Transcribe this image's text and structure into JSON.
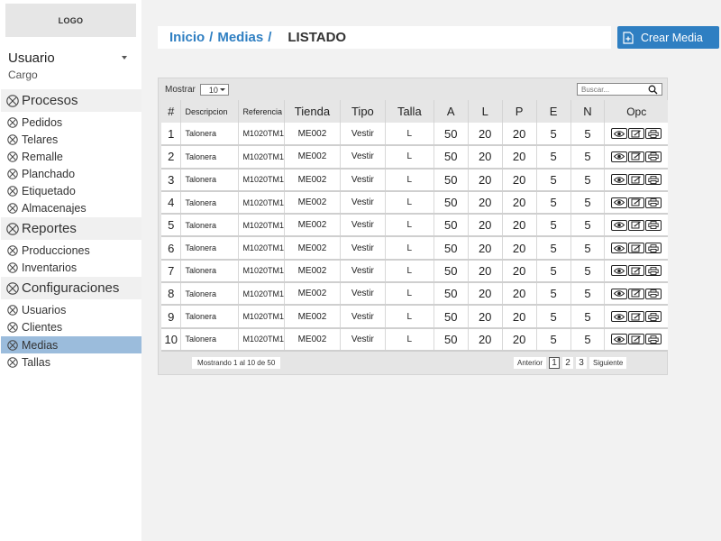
{
  "sidebar": {
    "logo": "LOGO",
    "user_name": "Usuario",
    "user_role": "Cargo",
    "sections": [
      {
        "label": "Procesos",
        "items": [
          "Pedidos",
          "Telares",
          "Remalle",
          "Planchado",
          "Etiquetado",
          "Almacenajes"
        ]
      },
      {
        "label": "Reportes",
        "items": [
          "Producciones",
          "Inventarios"
        ]
      },
      {
        "label": "Configuraciones",
        "items": [
          "Usuarios",
          "Clientes",
          "Medias",
          "Tallas"
        ]
      }
    ],
    "active_item": "Medias"
  },
  "breadcrumb": {
    "inicio": "Inicio",
    "medias": "Medias",
    "separator": "/",
    "current": "LISTADO"
  },
  "create_button": {
    "label": "Crear Media",
    "icon": "add-file-icon"
  },
  "toolbar": {
    "show_label": "Mostrar",
    "page_size": "10",
    "search_placeholder": "Buscar..."
  },
  "table": {
    "columns": [
      "#",
      "Descripcion",
      "Referencia",
      "Tienda",
      "Tipo",
      "Talla",
      "A",
      "L",
      "P",
      "E",
      "N",
      "Opc"
    ],
    "rows": [
      [
        "1",
        "Talonera",
        "M1020TM1",
        "ME002",
        "Vestir",
        "L",
        "50",
        "20",
        "20",
        "5",
        "5"
      ],
      [
        "2",
        "Talonera",
        "M1020TM1",
        "ME002",
        "Vestir",
        "L",
        "50",
        "20",
        "20",
        "5",
        "5"
      ],
      [
        "3",
        "Talonera",
        "M1020TM1",
        "ME002",
        "Vestir",
        "L",
        "50",
        "20",
        "20",
        "5",
        "5"
      ],
      [
        "4",
        "Talonera",
        "M1020TM1",
        "ME002",
        "Vestir",
        "L",
        "50",
        "20",
        "20",
        "5",
        "5"
      ],
      [
        "5",
        "Talonera",
        "M1020TM1",
        "ME002",
        "Vestir",
        "L",
        "50",
        "20",
        "20",
        "5",
        "5"
      ],
      [
        "6",
        "Talonera",
        "M1020TM1",
        "ME002",
        "Vestir",
        "L",
        "50",
        "20",
        "20",
        "5",
        "5"
      ],
      [
        "7",
        "Talonera",
        "M1020TM1",
        "ME002",
        "Vestir",
        "L",
        "50",
        "20",
        "20",
        "5",
        "5"
      ],
      [
        "8",
        "Talonera",
        "M1020TM1",
        "ME002",
        "Vestir",
        "L",
        "50",
        "20",
        "20",
        "5",
        "5"
      ],
      [
        "9",
        "Talonera",
        "M1020TM1",
        "ME002",
        "Vestir",
        "L",
        "50",
        "20",
        "20",
        "5",
        "5"
      ],
      [
        "10",
        "Talonera",
        "M1020TM1",
        "ME002",
        "Vestir",
        "L",
        "50",
        "20",
        "20",
        "5",
        "5"
      ]
    ],
    "row_actions": [
      "view-eye-icon",
      "edit-icon",
      "print-icon"
    ]
  },
  "footer": {
    "info": "Mostrando 1 al 10 de 50",
    "prev": "Anterior",
    "pages": [
      "1",
      "2",
      "3"
    ],
    "current_page": "1",
    "next": "Siguiente"
  },
  "colors": {
    "accent": "#2f7fc2",
    "active_item_bg": "#9bbcdc",
    "page_bg": "#f2f2f2",
    "panel_bg": "#e5e5e5"
  }
}
